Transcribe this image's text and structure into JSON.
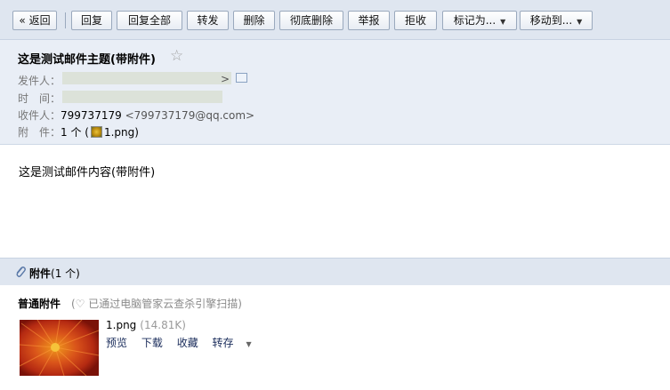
{
  "toolbar": {
    "back": "« 返回",
    "reply": "回复",
    "reply_all": "回复全部",
    "forward": "转发",
    "delete": "删除",
    "delete_permanent": "彻底删除",
    "report": "举报",
    "reject": "拒收",
    "mark_as": "标记为...",
    "move_to": "移动到..."
  },
  "header": {
    "subject": "这是测试邮件主题(带附件)",
    "star_icon": "☆",
    "sender_label": "发件人：",
    "sender_tail": "> ",
    "time_label": "时　间：",
    "recipient_label": "收件人：",
    "recipient_name": "799737179",
    "recipient_email": "<799737179@qq.com>",
    "attach_label": "附　件：",
    "attach_count": "1 个 (",
    "attach_file": "1.png",
    "attach_close": ")"
  },
  "body": {
    "text": "这是测试邮件内容(带附件)"
  },
  "attachments": {
    "title_bold": "附件",
    "title_count": "(1 个)",
    "group_label": "普通附件",
    "scan_note": "(♡ 已通过电脑管家云查杀引擎扫描)",
    "file": {
      "name": "1.png",
      "size": "(14.81K)",
      "preview": "预览",
      "download": "下载",
      "favorite": "收藏",
      "save_to": "转存"
    }
  }
}
